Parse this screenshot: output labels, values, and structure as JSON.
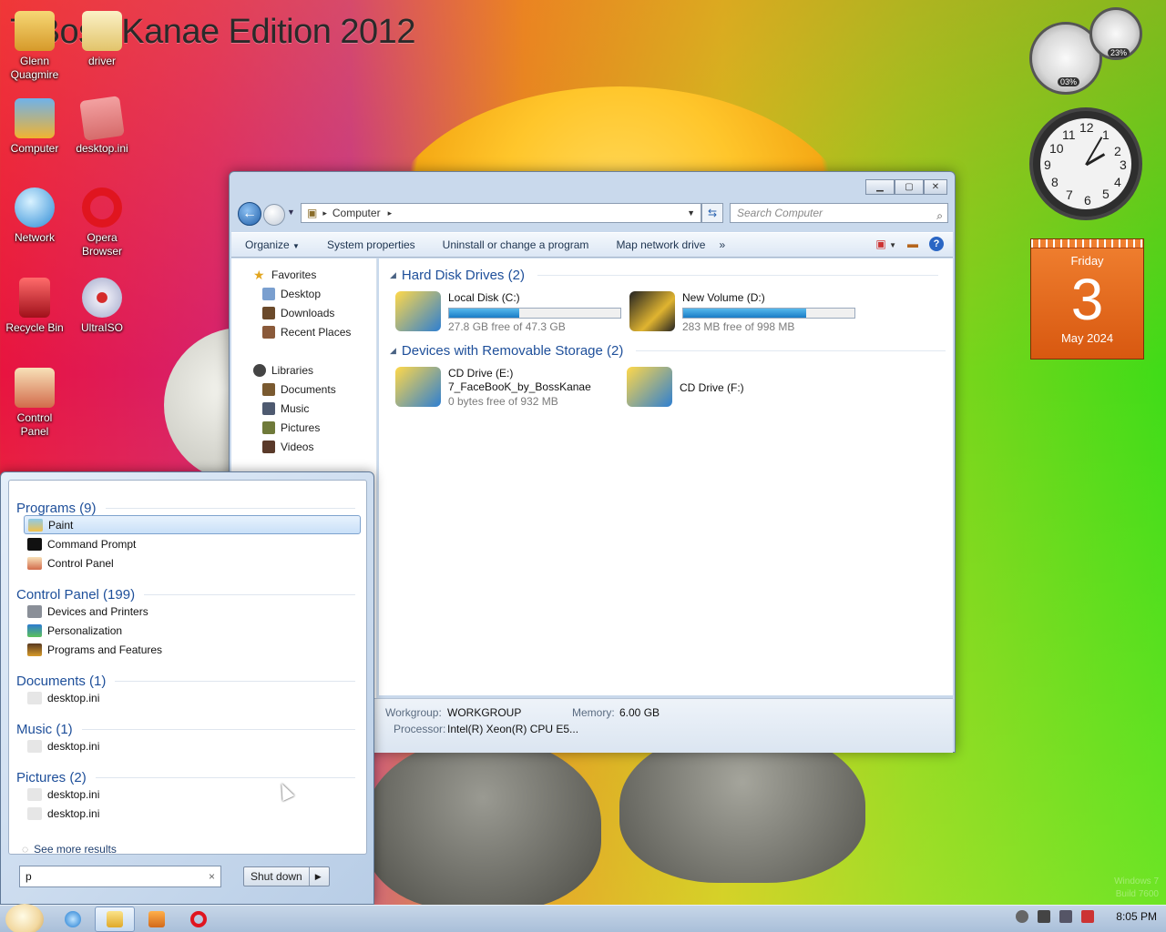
{
  "desktop": {
    "brand_text": "7 Boss Kanae Edition 2012",
    "icons": [
      {
        "label": "Glenn Quagmire",
        "icon": "folder-icon"
      },
      {
        "label": "driver",
        "icon": "folder-icon"
      },
      {
        "label": "Computer",
        "icon": "computer-icon"
      },
      {
        "label": "desktop.ini",
        "icon": "file-icon"
      },
      {
        "label": "Network",
        "icon": "network-icon"
      },
      {
        "label": "Opera Browser",
        "icon": "opera-icon"
      },
      {
        "label": "Recycle Bin",
        "icon": "recycle-bin-icon"
      },
      {
        "label": "UltraISO",
        "icon": "disc-icon"
      },
      {
        "label": "Control Panel",
        "icon": "control-panel-icon"
      }
    ],
    "watermark": [
      "Windows 7",
      "Build 7600"
    ]
  },
  "gadgets": {
    "cpu_meter": {
      "cpu_pct": "03%",
      "mem_pct": "23%"
    },
    "clock": {
      "numbers": [
        "12",
        "1",
        "2",
        "3",
        "4",
        "5",
        "6",
        "7",
        "8",
        "9",
        "10",
        "11"
      ]
    },
    "calendar": {
      "weekday": "Friday",
      "day": "3",
      "month_year": "May 2024"
    }
  },
  "explorer": {
    "address": {
      "crumb": "Computer",
      "search_placeholder": "Search Computer"
    },
    "commands": [
      "Organize",
      "System properties",
      "Uninstall or change a program",
      "Map network drive",
      "»"
    ],
    "nav": {
      "favorites_label": "Favorites",
      "favorites": [
        "Desktop",
        "Downloads",
        "Recent Places"
      ],
      "libraries_label": "Libraries",
      "libraries": [
        "Documents",
        "Music",
        "Pictures",
        "Videos"
      ]
    },
    "groups": {
      "hdd": "Hard Disk Drives (2)",
      "removable": "Devices with Removable Storage (2)"
    },
    "drives": [
      {
        "name": "Local Disk (C:)",
        "free": "27.8 GB free of 47.3 GB",
        "used_fraction": 0.41
      },
      {
        "name": "New Volume (D:)",
        "free": "283 MB free of 998 MB",
        "used_fraction": 0.72
      }
    ],
    "removable": [
      {
        "name": "CD Drive (E:)",
        "label": "7_FaceBooK_by_BossKanae",
        "free": "0 bytes free of 932 MB"
      },
      {
        "name": "CD Drive (F:)"
      }
    ],
    "details": {
      "workgroup_label": "Workgroup:",
      "workgroup": "WORKGROUP",
      "memory_label": "Memory:",
      "memory": "6.00 GB",
      "processor_label": "Processor:",
      "processor": "Intel(R) Xeon(R) CPU E5..."
    }
  },
  "start_menu": {
    "sections": [
      {
        "title": "Programs (9)",
        "items": [
          "Paint",
          "Command Prompt",
          "Control Panel"
        ]
      },
      {
        "title": "Control Panel (199)",
        "items": [
          "Devices and Printers",
          "Personalization",
          "Programs and Features"
        ]
      },
      {
        "title": "Documents (1)",
        "items": [
          "desktop.ini"
        ]
      },
      {
        "title": "Music (1)",
        "items": [
          "desktop.ini"
        ]
      },
      {
        "title": "Pictures (2)",
        "items": [
          "desktop.ini",
          "desktop.ini"
        ]
      }
    ],
    "see_more": "See more results",
    "search_value": "p",
    "shutdown_label": "Shut down"
  },
  "taskbar": {
    "time": "8:05 PM"
  }
}
